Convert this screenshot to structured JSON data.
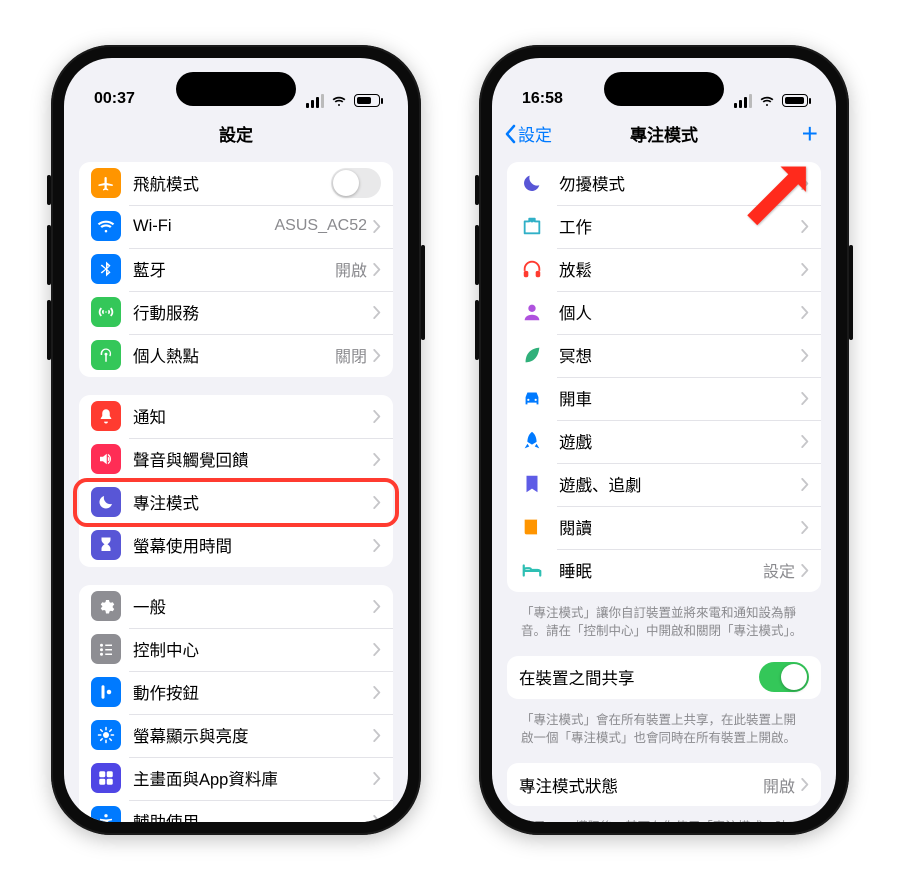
{
  "left": {
    "status": {
      "time": "00:37"
    },
    "title": "設定",
    "group1": [
      {
        "label": "飛航模式",
        "value": "",
        "iconColor": "#ff9500",
        "icon": "airplane",
        "toggle": true,
        "toggleOn": false
      },
      {
        "label": "Wi-Fi",
        "value": "ASUS_AC52",
        "iconColor": "#007aff",
        "icon": "wifi"
      },
      {
        "label": "藍牙",
        "value": "開啟",
        "iconColor": "#007aff",
        "icon": "bluetooth"
      },
      {
        "label": "行動服務",
        "value": "",
        "iconColor": "#34c759",
        "icon": "cellular"
      },
      {
        "label": "個人熱點",
        "value": "關閉",
        "iconColor": "#34c759",
        "icon": "hotspot"
      }
    ],
    "group2": [
      {
        "label": "通知",
        "value": "",
        "iconColor": "#ff3b30",
        "icon": "bell"
      },
      {
        "label": "聲音與觸覺回饋",
        "value": "",
        "iconColor": "#ff2d55",
        "icon": "sound"
      },
      {
        "label": "專注模式",
        "value": "",
        "iconColor": "#5856d6",
        "icon": "moon",
        "highlighted": true
      },
      {
        "label": "螢幕使用時間",
        "value": "",
        "iconColor": "#5856d6",
        "icon": "hourglass"
      }
    ],
    "group3": [
      {
        "label": "一般",
        "value": "",
        "iconColor": "#8e8e93",
        "icon": "gear"
      },
      {
        "label": "控制中心",
        "value": "",
        "iconColor": "#8e8e93",
        "icon": "control"
      },
      {
        "label": "動作按鈕",
        "value": "",
        "iconColor": "#007aff",
        "icon": "action"
      },
      {
        "label": "螢幕顯示與亮度",
        "value": "",
        "iconColor": "#007aff",
        "icon": "brightness"
      },
      {
        "label": "主畫面與App資料庫",
        "value": "",
        "iconColor": "#4f46e5",
        "icon": "grid"
      },
      {
        "label": "輔助使用",
        "value": "",
        "iconColor": "#007aff",
        "icon": "accessibility"
      }
    ]
  },
  "right": {
    "status": {
      "time": "16:58"
    },
    "back": "設定",
    "title": "專注模式",
    "plus": "+",
    "modes": [
      {
        "label": "勿擾模式",
        "color": "#5856d6",
        "icon": "moon"
      },
      {
        "label": "工作",
        "color": "#30b0c7",
        "icon": "briefcase"
      },
      {
        "label": "放鬆",
        "color": "#ff3b30",
        "icon": "headphones"
      },
      {
        "label": "個人",
        "color": "#af52de",
        "icon": "person"
      },
      {
        "label": "冥想",
        "color": "#30b07a",
        "icon": "leaf"
      },
      {
        "label": "開車",
        "color": "#007aff",
        "icon": "car"
      },
      {
        "label": "遊戲",
        "color": "#007aff",
        "icon": "rocket"
      },
      {
        "label": "遊戲、追劇",
        "color": "#5e5ce6",
        "icon": "bookmark"
      },
      {
        "label": "閱讀",
        "color": "#ff9500",
        "icon": "book"
      },
      {
        "label": "睡眠",
        "color": "#2ebfb3",
        "icon": "bed",
        "value": "設定"
      }
    ],
    "note1": "「專注模式」讓你自訂裝置並將來電和通知設為靜音。請在「控制中心」中開啟和關閉「專注模式」。",
    "shareRow": {
      "label": "在裝置之間共享",
      "on": true
    },
    "note2": "「專注模式」會在所有裝置上共享，在此裝置上開啟一個「專注模式」也會同時在所有裝置上開啟。",
    "statusRow": {
      "label": "專注模式狀態",
      "value": "開啟"
    },
    "note3": "給予 App 權限後，其可在你使用「專注模式」時，分享你已將通知設為靜音。"
  }
}
